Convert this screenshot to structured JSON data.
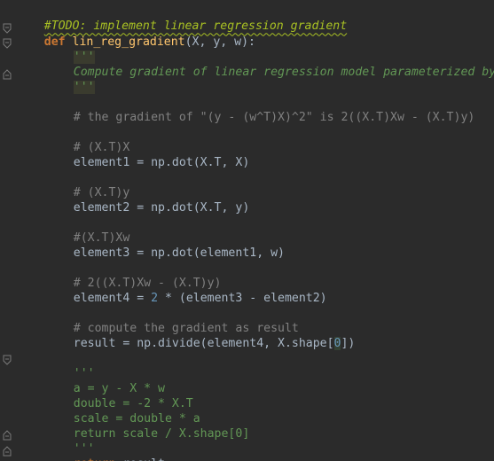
{
  "code": {
    "todo_comment": "#TODO: implement linear regression gradient",
    "def_keyword": "def",
    "function_name": "lin_reg_gradient",
    "signature_rest": "(X, y, w):",
    "docstring_open": "'''",
    "docstring_text": "Compute gradient of linear regression model parameterized by w",
    "docstring_close": "'''",
    "comment_gradient": "# the gradient of \"(y - (w^T)X)^2\" is 2((X.T)Xw - (X.T)y)",
    "comment_xtx": "# (X.T)X",
    "element1_line": "element1 = np.dot(X.T, X)",
    "comment_xty": "# (X.T)y",
    "element2_line": "element2 = np.dot(X.T, y)",
    "comment_xtxw": "#(X.T)Xw",
    "element3_line": "element3 = np.dot(element1, w)",
    "comment_diff": "# 2((X.T)Xw - (X.T)y)",
    "element4_prefix": "element4 = ",
    "element4_num": "2",
    "element4_suffix": " * (element3 - element2)",
    "comment_result": "# compute the gradient as result",
    "result_prefix": "result = np.divide(element4, X.shape[",
    "result_index": "0",
    "result_suffix": "])",
    "block_open": "'''",
    "block_line1": "a = y - X * w",
    "block_line2": "double = -2 * X.T",
    "block_line3": "scale = double * a",
    "block_line4": "return scale / X.shape[0]",
    "block_close": "'''",
    "return_keyword": "return",
    "return_value": " result"
  }
}
